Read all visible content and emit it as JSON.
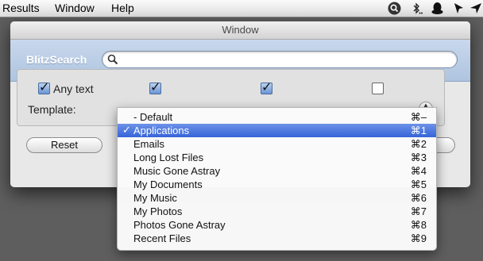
{
  "menubar": {
    "items": [
      "Results",
      "Window",
      "Help"
    ],
    "status_icons": [
      "spotlight-search-icon",
      "bluetooth-icon",
      "qq-penguin-icon",
      "cursor-arrow-icon",
      "send-arrow-icon"
    ]
  },
  "window": {
    "title": "Window",
    "brand": "BlitzSearch",
    "search": {
      "value": "",
      "placeholder": ""
    }
  },
  "options": {
    "checkboxes": [
      {
        "label": "Any text",
        "checked": true
      }
    ],
    "template_label": "Template:"
  },
  "buttons": {
    "reset": "Reset"
  },
  "menu": {
    "items": [
      {
        "label": "- Default",
        "shortcut": "⌘–",
        "checked": false,
        "selected": false
      },
      {
        "label": "Applications",
        "shortcut": "⌘1",
        "checked": true,
        "selected": true
      },
      {
        "label": "Emails",
        "shortcut": "⌘2",
        "checked": false,
        "selected": false
      },
      {
        "label": "Long Lost Files",
        "shortcut": "⌘3",
        "checked": false,
        "selected": false
      },
      {
        "label": "Music Gone Astray",
        "shortcut": "⌘4",
        "checked": false,
        "selected": false
      },
      {
        "label": "My Documents",
        "shortcut": "⌘5",
        "checked": false,
        "selected": false
      },
      {
        "label": "My Music",
        "shortcut": "⌘6",
        "checked": false,
        "selected": false
      },
      {
        "label": "My Photos",
        "shortcut": "⌘7",
        "checked": false,
        "selected": false
      },
      {
        "label": "Photos Gone Astray",
        "shortcut": "⌘8",
        "checked": false,
        "selected": false
      },
      {
        "label": "Recent Files",
        "shortcut": "⌘9",
        "checked": false,
        "selected": false
      }
    ],
    "check_glyph": "✓"
  },
  "colors": {
    "selection": "#3d6be0",
    "search_band": "#b6c9e3"
  }
}
